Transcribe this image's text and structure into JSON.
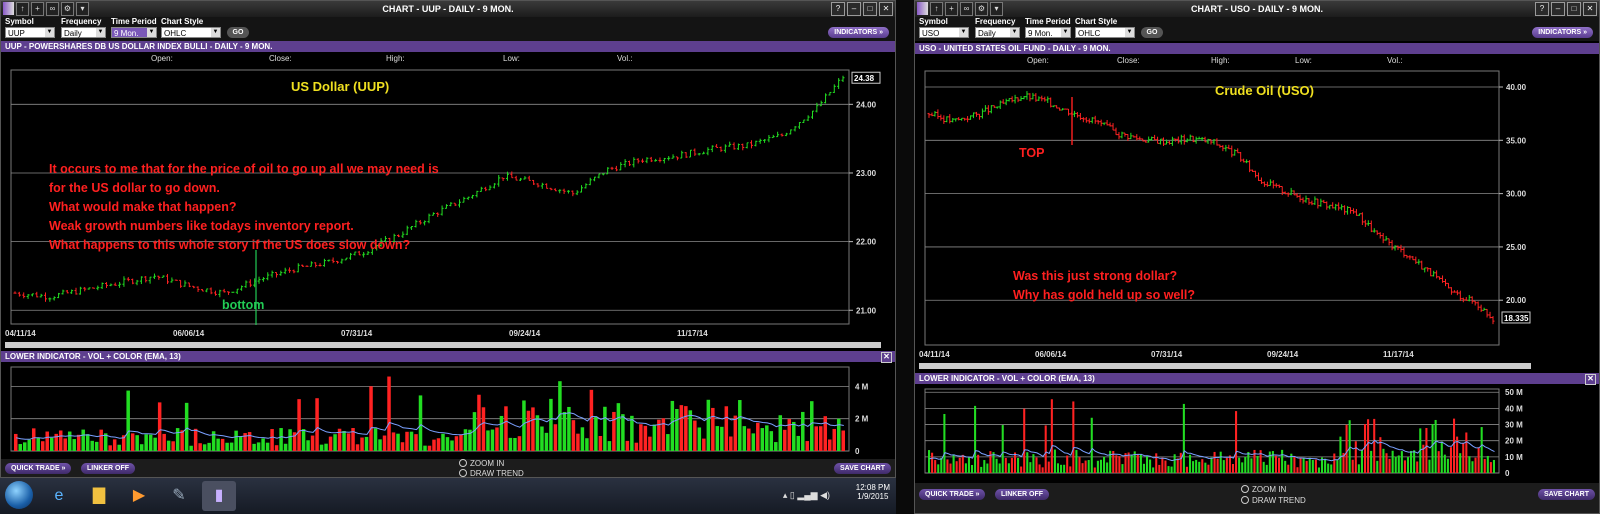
{
  "left": {
    "title": "CHART - UUP - DAILY - 9 MON.",
    "controls": {
      "symbol_label": "Symbol",
      "symbol": "UUP",
      "frequency_label": "Frequency",
      "frequency": "Daily",
      "period_label": "Time Period",
      "period": "9 Mon.",
      "style_label": "Chart Style",
      "style": "OHLC",
      "go": "GO",
      "indicators": "INDICATORS »"
    },
    "header": "UUP - POWERSHARES DB US DOLLAR INDEX BULLI - DAILY - 9 MON.",
    "ohlc": {
      "open": "Open:",
      "close": "Close:",
      "high": "High:",
      "low": "Low:",
      "vol": "Vol.:"
    },
    "lower_header": "LOWER INDICATOR - VOL + COLOR (EMA, 13)",
    "quick_trade": "QUICK TRADE »",
    "linker": "LINKER OFF",
    "zoom_in": "ZOOM IN",
    "draw_trend": "DRAW TREND",
    "save_chart": "SAVE CHART"
  },
  "right": {
    "title": "CHART - USO - DAILY - 9 MON.",
    "controls": {
      "symbol_label": "Symbol",
      "symbol": "USO",
      "frequency_label": "Frequency",
      "frequency": "Daily",
      "period_label": "Time Period",
      "period": "9 Mon.",
      "style_label": "Chart Style",
      "style": "OHLC",
      "go": "GO",
      "indicators": "INDICATORS »"
    },
    "header": "USO - UNITED STATES OIL FUND - DAILY - 9 MON.",
    "ohlc": {
      "open": "Open:",
      "close": "Close:",
      "high": "High:",
      "low": "Low:",
      "vol": "Vol.:"
    },
    "lower_header": "LOWER INDICATOR - VOL + COLOR (EMA, 13)",
    "quick_trade": "QUICK TRADE »",
    "linker": "LINKER OFF",
    "zoom_in": "ZOOM IN",
    "draw_trend": "DRAW TREND",
    "save_chart": "SAVE CHART"
  },
  "taskbar": {
    "time": "12:08 PM",
    "date": "1/9/2015"
  },
  "colors": {
    "accent": "#5e3f8f",
    "up": "#22dd22",
    "down": "#ff2222",
    "annotation_red": "#ff2020",
    "annotation_yellow": "#f0e020",
    "annotation_green": "#22cc55"
  },
  "chart_data": [
    {
      "type": "line",
      "title": "US Dollar (UUP)",
      "x_ticks": [
        "04/11/14",
        "06/06/14",
        "07/31/14",
        "09/24/14",
        "11/17/14"
      ],
      "y_ticks": [
        "21.00",
        "22.00",
        "23.00",
        "24.00"
      ],
      "ylim": [
        20.8,
        24.5
      ],
      "last_price": "24.38",
      "x": [
        0,
        8,
        16,
        24,
        32,
        40,
        48,
        56,
        64,
        72,
        80,
        88,
        96,
        104,
        112,
        120,
        128,
        136,
        144,
        152,
        160,
        168,
        176,
        184,
        190
      ],
      "y": [
        21.25,
        21.2,
        21.3,
        21.4,
        21.5,
        21.35,
        21.25,
        21.45,
        21.6,
        21.7,
        21.85,
        22.1,
        22.4,
        22.65,
        22.95,
        22.85,
        22.7,
        23.05,
        23.2,
        23.25,
        23.35,
        23.4,
        23.55,
        23.95,
        24.4
      ],
      "annotations": [
        {
          "text": "US Dollar (UUP)"
        },
        {
          "text": "It occurs to me that for the price of oil to go up all we may need is"
        },
        {
          "text": "for the US dollar to go down."
        },
        {
          "text": "What would make that happen?"
        },
        {
          "text": "Weak growth numbers like todays inventory report."
        },
        {
          "text": "What happens to this whole story if the US does slow down?"
        },
        {
          "text": "bottom"
        }
      ]
    },
    {
      "type": "bar",
      "title": "LOWER INDICATOR - VOL + COLOR (EMA, 13)",
      "y_ticks": [
        "0",
        "2 M",
        "4 M"
      ],
      "ylim": [
        0,
        5.2
      ]
    },
    {
      "type": "line",
      "title": "Crude Oil (USO)",
      "x_ticks": [
        "04/11/14",
        "06/06/14",
        "07/31/14",
        "09/24/14",
        "11/17/14"
      ],
      "y_ticks": [
        "20.00",
        "25.00",
        "30.00",
        "35.00",
        "40.00"
      ],
      "ylim": [
        15.8,
        41.5
      ],
      "last_price": "18.335",
      "x": [
        0,
        8,
        16,
        24,
        32,
        40,
        48,
        56,
        64,
        72,
        80,
        88,
        96,
        104,
        112,
        120,
        128,
        136,
        144,
        152,
        160,
        168,
        176,
        184,
        190
      ],
      "y": [
        37.5,
        36.8,
        37.4,
        38.3,
        39.2,
        38.6,
        37.6,
        36.8,
        35.6,
        35.1,
        34.9,
        35.2,
        34.8,
        33.6,
        31.2,
        30.2,
        29.4,
        28.8,
        28.2,
        25.8,
        24.5,
        22.8,
        20.8,
        19.8,
        18.3
      ],
      "annotations": [
        {
          "text": "Crude Oil (USO)"
        },
        {
          "text": "TOP"
        },
        {
          "text": "Was this just strong dollar?"
        },
        {
          "text": "Why has gold held up so well?"
        }
      ]
    },
    {
      "type": "bar",
      "title": "LOWER INDICATOR - VOL + COLOR (EMA, 13)",
      "y_ticks": [
        "0",
        "10 M",
        "20 M",
        "30 M",
        "40 M",
        "50 M"
      ],
      "ylim": [
        0,
        52
      ]
    }
  ]
}
